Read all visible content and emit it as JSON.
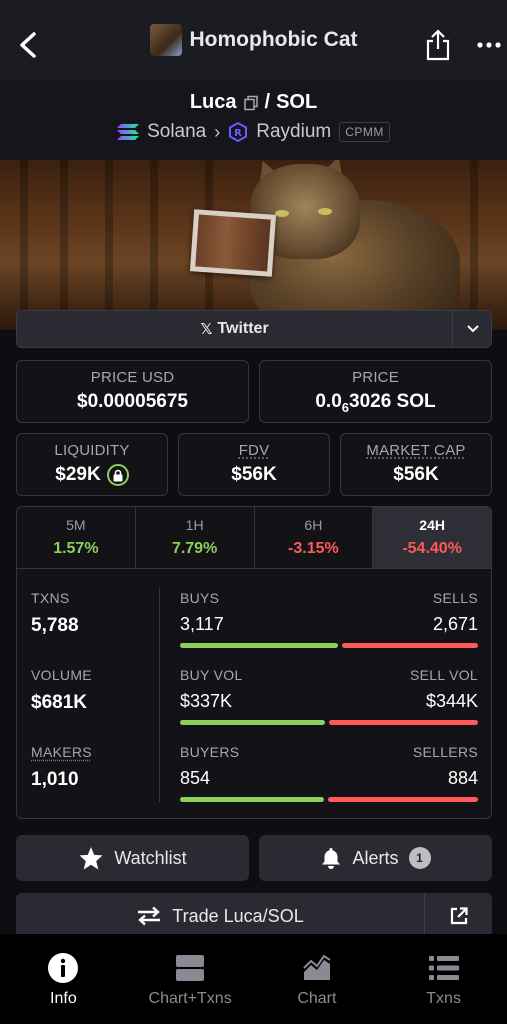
{
  "header": {
    "title": "Homophobic Cat"
  },
  "pair": {
    "base": "Luca",
    "separator": "/",
    "quote": "SOL",
    "chain": "Solana",
    "dex": "Raydium",
    "pool_type": "CPMM"
  },
  "social": {
    "twitter_label": "Twitter"
  },
  "price": {
    "usd_label": "PRICE USD",
    "usd_value": "$0.00005675",
    "native_label": "PRICE",
    "native_prefix": "0.0",
    "native_zeros": "6",
    "native_rest": "3026 SOL"
  },
  "metrics": {
    "liquidity_label": "LIQUIDITY",
    "liquidity_value": "$29K",
    "fdv_label": "FDV",
    "fdv_value": "$56K",
    "mcap_label": "MARKET CAP",
    "mcap_value": "$56K"
  },
  "timeframes": [
    {
      "label": "5M",
      "value": "1.57%"
    },
    {
      "label": "1H",
      "value": "7.79%"
    },
    {
      "label": "6H",
      "value": "-3.15%"
    },
    {
      "label": "24H",
      "value": "-54.40%"
    }
  ],
  "stats": {
    "txns_label": "TXNS",
    "txns_value": "5,788",
    "volume_label": "VOLUME",
    "volume_value": "$681K",
    "makers_label": "MAKERS",
    "makers_value": "1,010",
    "buys_label": "BUYS",
    "buys_value": "3,117",
    "sells_label": "SELLS",
    "sells_value": "2,671",
    "buy_vol_label": "BUY VOL",
    "buy_vol_value": "$337K",
    "sell_vol_label": "SELL VOL",
    "sell_vol_value": "$344K",
    "buyers_label": "BUYERS",
    "buyers_value": "854",
    "sellers_label": "SELLERS",
    "sellers_value": "884"
  },
  "actions": {
    "watchlist_label": "Watchlist",
    "alerts_label": "Alerts",
    "alerts_count": "1",
    "trade_label": "Trade Luca/SOL"
  },
  "nav": [
    {
      "label": "Info",
      "icon": "info-icon"
    },
    {
      "label": "Chart+Txns",
      "icon": "chart-txns-icon"
    },
    {
      "label": "Chart",
      "icon": "chart-icon"
    },
    {
      "label": "Txns",
      "icon": "list-icon"
    }
  ],
  "colors": {
    "positive": "#8cd15a",
    "negative": "#ff5a5a",
    "background": "#0e0e12"
  }
}
